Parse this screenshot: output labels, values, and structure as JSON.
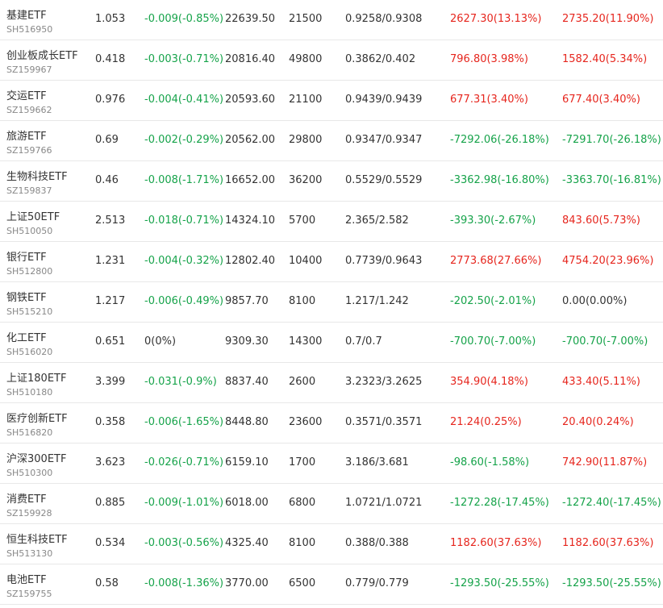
{
  "colors": {
    "up": "#e6261e",
    "down": "#16a34a",
    "flat": "#333333",
    "code": "#888888"
  },
  "rows": [
    {
      "name": "基建ETF",
      "code": "SH516950",
      "price": "1.053",
      "change": "-0.009(-0.85%)",
      "change_dir": "down",
      "amount": "22639.50",
      "volume": "21500",
      "range": "0.9258/0.9308",
      "pl1": "2627.30(13.13%)",
      "pl1_dir": "up",
      "pl2": "2735.20(11.90%)",
      "pl2_dir": "up"
    },
    {
      "name": "创业板成长ETF",
      "code": "SZ159967",
      "price": "0.418",
      "change": "-0.003(-0.71%)",
      "change_dir": "down",
      "amount": "20816.40",
      "volume": "49800",
      "range": "0.3862/0.402",
      "pl1": "796.80(3.98%)",
      "pl1_dir": "up",
      "pl2": "1582.40(5.34%)",
      "pl2_dir": "up"
    },
    {
      "name": "交运ETF",
      "code": "SZ159662",
      "price": "0.976",
      "change": "-0.004(-0.41%)",
      "change_dir": "down",
      "amount": "20593.60",
      "volume": "21100",
      "range": "0.9439/0.9439",
      "pl1": "677.31(3.40%)",
      "pl1_dir": "up",
      "pl2": "677.40(3.40%)",
      "pl2_dir": "up"
    },
    {
      "name": "旅游ETF",
      "code": "SZ159766",
      "price": "0.69",
      "change": "-0.002(-0.29%)",
      "change_dir": "down",
      "amount": "20562.00",
      "volume": "29800",
      "range": "0.9347/0.9347",
      "pl1": "-7292.06(-26.18%)",
      "pl1_dir": "down",
      "pl2": "-7291.70(-26.18%)",
      "pl2_dir": "down"
    },
    {
      "name": "生物科技ETF",
      "code": "SZ159837",
      "price": "0.46",
      "change": "-0.008(-1.71%)",
      "change_dir": "down",
      "amount": "16652.00",
      "volume": "36200",
      "range": "0.5529/0.5529",
      "pl1": "-3362.98(-16.80%)",
      "pl1_dir": "down",
      "pl2": "-3363.70(-16.81%)",
      "pl2_dir": "down"
    },
    {
      "name": "上证50ETF",
      "code": "SH510050",
      "price": "2.513",
      "change": "-0.018(-0.71%)",
      "change_dir": "down",
      "amount": "14324.10",
      "volume": "5700",
      "range": "2.365/2.582",
      "pl1": "-393.30(-2.67%)",
      "pl1_dir": "down",
      "pl2": "843.60(5.73%)",
      "pl2_dir": "up"
    },
    {
      "name": "银行ETF",
      "code": "SH512800",
      "price": "1.231",
      "change": "-0.004(-0.32%)",
      "change_dir": "down",
      "amount": "12802.40",
      "volume": "10400",
      "range": "0.7739/0.9643",
      "pl1": "2773.68(27.66%)",
      "pl1_dir": "up",
      "pl2": "4754.20(23.96%)",
      "pl2_dir": "up"
    },
    {
      "name": "钢铁ETF",
      "code": "SH515210",
      "price": "1.217",
      "change": "-0.006(-0.49%)",
      "change_dir": "down",
      "amount": "9857.70",
      "volume": "8100",
      "range": "1.217/1.242",
      "pl1": "-202.50(-2.01%)",
      "pl1_dir": "down",
      "pl2": "0.00(0.00%)",
      "pl2_dir": "flat"
    },
    {
      "name": "化工ETF",
      "code": "SH516020",
      "price": "0.651",
      "change": "0(0%)",
      "change_dir": "flat",
      "amount": "9309.30",
      "volume": "14300",
      "range": "0.7/0.7",
      "pl1": "-700.70(-7.00%)",
      "pl1_dir": "down",
      "pl2": "-700.70(-7.00%)",
      "pl2_dir": "down"
    },
    {
      "name": "上证180ETF",
      "code": "SH510180",
      "price": "3.399",
      "change": "-0.031(-0.9%)",
      "change_dir": "down",
      "amount": "8837.40",
      "volume": "2600",
      "range": "3.2323/3.2625",
      "pl1": "354.90(4.18%)",
      "pl1_dir": "up",
      "pl2": "433.40(5.11%)",
      "pl2_dir": "up"
    },
    {
      "name": "医疗创新ETF",
      "code": "SH516820",
      "price": "0.358",
      "change": "-0.006(-1.65%)",
      "change_dir": "down",
      "amount": "8448.80",
      "volume": "23600",
      "range": "0.3571/0.3571",
      "pl1": "21.24(0.25%)",
      "pl1_dir": "up",
      "pl2": "20.40(0.24%)",
      "pl2_dir": "up"
    },
    {
      "name": "沪深300ETF",
      "code": "SH510300",
      "price": "3.623",
      "change": "-0.026(-0.71%)",
      "change_dir": "down",
      "amount": "6159.10",
      "volume": "1700",
      "range": "3.186/3.681",
      "pl1": "-98.60(-1.58%)",
      "pl1_dir": "down",
      "pl2": "742.90(11.87%)",
      "pl2_dir": "up"
    },
    {
      "name": "消费ETF",
      "code": "SZ159928",
      "price": "0.885",
      "change": "-0.009(-1.01%)",
      "change_dir": "down",
      "amount": "6018.00",
      "volume": "6800",
      "range": "1.0721/1.0721",
      "pl1": "-1272.28(-17.45%)",
      "pl1_dir": "down",
      "pl2": "-1272.40(-17.45%)",
      "pl2_dir": "down"
    },
    {
      "name": "恒生科技ETF",
      "code": "SH513130",
      "price": "0.534",
      "change": "-0.003(-0.56%)",
      "change_dir": "down",
      "amount": "4325.40",
      "volume": "8100",
      "range": "0.388/0.388",
      "pl1": "1182.60(37.63%)",
      "pl1_dir": "up",
      "pl2": "1182.60(37.63%)",
      "pl2_dir": "up"
    },
    {
      "name": "电池ETF",
      "code": "SZ159755",
      "price": "0.58",
      "change": "-0.008(-1.36%)",
      "change_dir": "down",
      "amount": "3770.00",
      "volume": "6500",
      "range": "0.779/0.779",
      "pl1": "-1293.50(-25.55%)",
      "pl1_dir": "down",
      "pl2": "-1293.50(-25.55%)",
      "pl2_dir": "down"
    }
  ]
}
